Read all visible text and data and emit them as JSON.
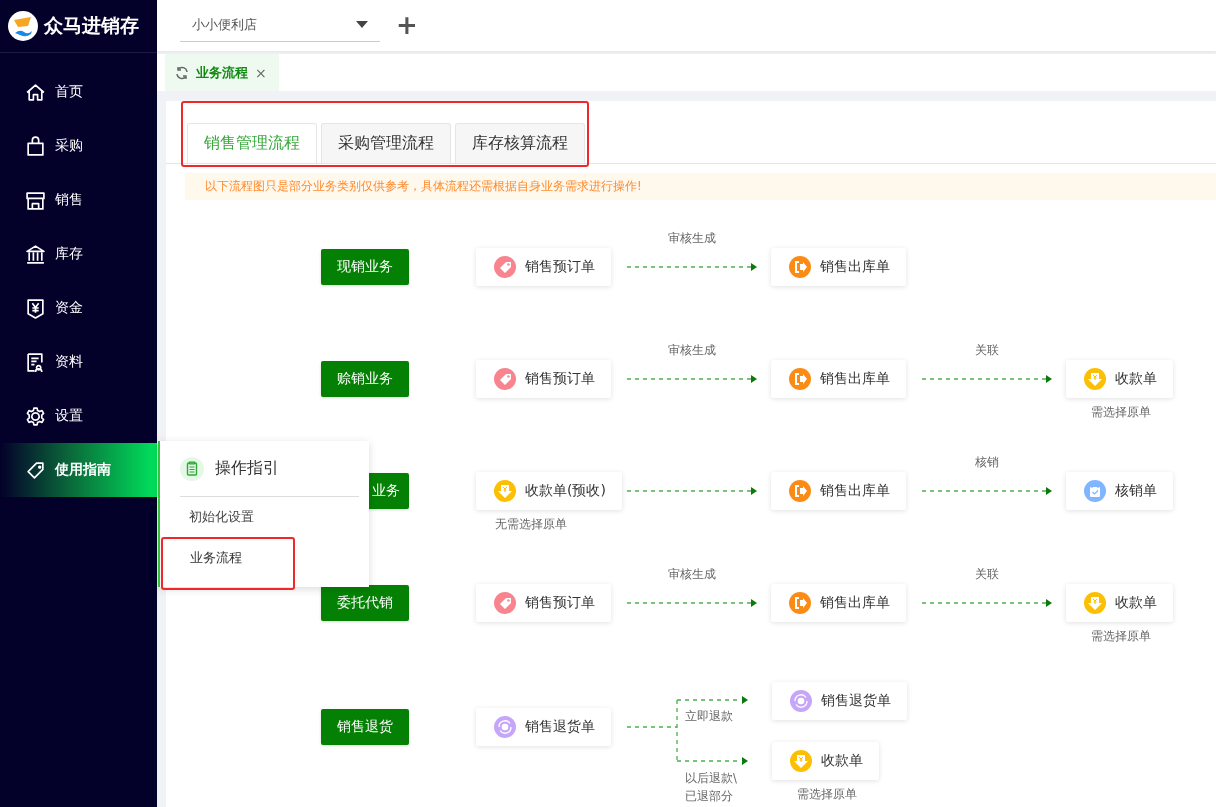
{
  "app": {
    "name": "众马进销存"
  },
  "sidebar": {
    "items": [
      {
        "label": "首页",
        "selected": false
      },
      {
        "label": "采购",
        "selected": false
      },
      {
        "label": "销售",
        "selected": false
      },
      {
        "label": "库存",
        "selected": false
      },
      {
        "label": "资金",
        "selected": false
      },
      {
        "label": "资料",
        "selected": false
      },
      {
        "label": "设置",
        "selected": false
      },
      {
        "label": "使用指南",
        "selected": true
      }
    ]
  },
  "topbar": {
    "store_select": {
      "value": "小小便利店"
    },
    "add_button": "+"
  },
  "page_tabs": [
    {
      "label": "业务流程",
      "selected": true,
      "close": "×"
    }
  ],
  "flow_tabs": [
    {
      "label": "销售管理流程",
      "selected": true
    },
    {
      "label": "采购管理流程",
      "selected": false
    },
    {
      "label": "库存核算流程",
      "selected": false
    }
  ],
  "notice": "以下流程图只是部分业务类别仅供参考，具体流程还需根据自身业务需求进行操作!",
  "flows": [
    {
      "kind": "chain",
      "button": {
        "label": "现销业务",
        "covered": false
      },
      "nodes": [
        {
          "text": "销售预订单",
          "kind": "order"
        },
        {
          "text": "销售出库单",
          "kind": "outbound",
          "via": "审核生成"
        }
      ]
    },
    {
      "kind": "chain",
      "button": {
        "label": "赊销业务",
        "covered": false
      },
      "nodes": [
        {
          "text": "销售预订单",
          "kind": "order"
        },
        {
          "text": "销售出库单",
          "kind": "outbound",
          "via": "审核生成"
        },
        {
          "text": "收款单",
          "kind": "receipt",
          "note": "需选择原单",
          "via": "关联"
        }
      ]
    },
    {
      "kind": "chain",
      "button": {
        "label": "业务",
        "covered": true
      },
      "nodes": [
        {
          "text": "收款单(预收)",
          "kind": "receipt",
          "note": "无需选择原单"
        },
        {
          "text": "销售出库单",
          "kind": "outbound"
        },
        {
          "text": "核销单",
          "kind": "writeoff",
          "via": "核销"
        }
      ]
    },
    {
      "kind": "chain",
      "button": {
        "label": "委托代销",
        "covered": false
      },
      "nodes": [
        {
          "text": "销售预订单",
          "kind": "order"
        },
        {
          "text": "销售出库单",
          "kind": "outbound",
          "via": "审核生成"
        },
        {
          "text": "收款单",
          "kind": "receipt",
          "note": "需选择原单",
          "via": "关联"
        }
      ]
    },
    {
      "kind": "branch",
      "button": {
        "label": "销售退货",
        "covered": false
      },
      "source": {
        "text": "销售退货单",
        "kind": "return"
      },
      "branches": [
        {
          "label": "立即退款",
          "node": {
            "text": "销售退货单",
            "kind": "return"
          }
        },
        {
          "label": "以后退款\\",
          "label_2": "已退部分",
          "node": {
            "text": "收款单",
            "kind": "receipt",
            "note": "需选择原单"
          }
        }
      ]
    }
  ],
  "guide_menu": {
    "title": "操作指引",
    "items": [
      {
        "label": "初始化设置",
        "selected": false
      },
      {
        "label": "业务流程",
        "selected": true
      }
    ]
  }
}
